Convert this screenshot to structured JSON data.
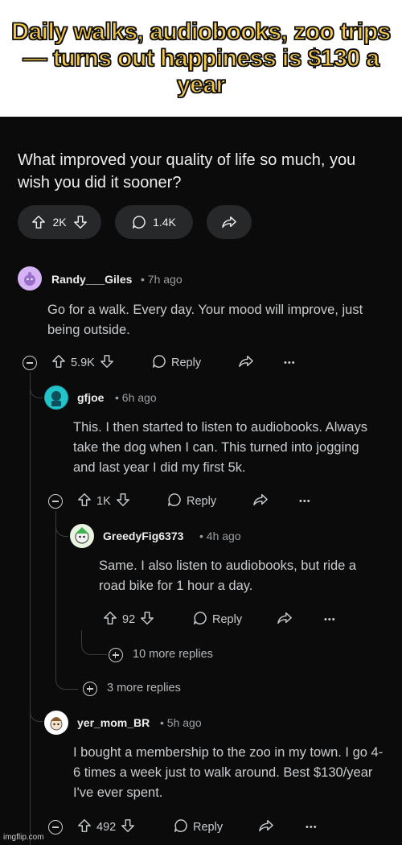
{
  "caption": "Daily walks, audiobooks, zoo trips — turns out happiness is $130 a year",
  "post": {
    "title": "What improved your quality of life so much, you wish you did it sooner?",
    "votes": "2K",
    "comments": "1.4K"
  },
  "comments": [
    {
      "user": "Randy___Giles",
      "time": "• 7h ago",
      "text": "Go for a walk. Every day. Your mood will improve, just being outside.",
      "votes": "5.9K",
      "reply": "Reply",
      "more": "•••"
    },
    {
      "user": "gfjoe",
      "time": "• 6h ago",
      "text": "This. I then started to listen to audiobooks. Always take the dog when I can. This turned into jogging and last year I did my first 5k.",
      "votes": "1K",
      "reply": "Reply",
      "more": "•••"
    },
    {
      "user": "GreedyFig6373",
      "time": "• 4h ago",
      "text": "Same. I also listen to audiobooks, but ride a road bike for 1 hour a day.",
      "votes": "92",
      "reply": "Reply",
      "more": "•••"
    },
    {
      "user": "yer_mom_BR",
      "time": "• 5h ago",
      "text": "I bought a membership to the zoo in my town. I go 4-6 times a week just to walk around. Best $130/year I've ever spent.",
      "votes": "492",
      "reply": "Reply",
      "more": "•••"
    }
  ],
  "more_replies": [
    "10 more replies",
    "3 more replies"
  ],
  "watermark": "imgflip.com",
  "colors": {
    "caption_fill": "#f6c94a",
    "background": "#0b0b0c",
    "pill": "#26282a"
  }
}
